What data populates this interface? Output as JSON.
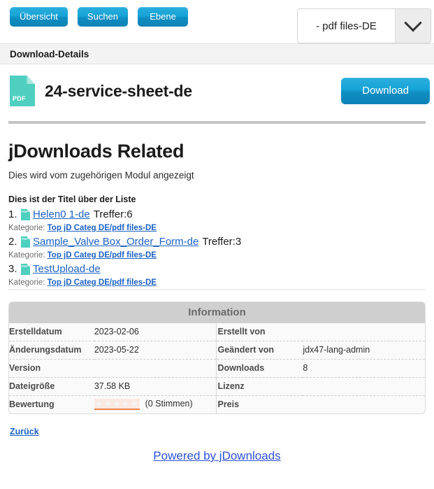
{
  "toolbar": {
    "buttons": [
      {
        "label": "Übersicht",
        "name": "overview-button"
      },
      {
        "label": "Suchen",
        "name": "search-button"
      },
      {
        "label": "Ebene",
        "name": "level-button"
      }
    ],
    "category_select": {
      "value": "- pdf files-DE",
      "icon": "chevron-down-icon"
    }
  },
  "details_band": {
    "title": "Download-Details"
  },
  "download": {
    "file_icon": "pdf-file-icon",
    "file_icon_label": "PDF",
    "title": "24-service-sheet-de",
    "button_label": "Download"
  },
  "related": {
    "heading": "jDownloads Related",
    "lead": "Dies wird vom zugehörigen Modul angezeigt",
    "list_title": "Dies ist der Titel über der Liste",
    "category_prefix": "Kategorie:",
    "items": [
      {
        "number": "1.",
        "link": "Helen0 1-de",
        "hits": "Treffer:6",
        "category": "Top jD Categ DE/pdf files-DE"
      },
      {
        "number": "2.",
        "link": "Sample_Valve Box_Order_Form-de",
        "hits": "Treffer:3",
        "category": "Top jD Categ DE/pdf files-DE"
      },
      {
        "number": "3.",
        "link": "TestUpload-de",
        "hits": "",
        "category": "Top jD Categ DE/pdf files-DE"
      }
    ]
  },
  "info_table": {
    "header": "Information",
    "rows": [
      {
        "left_label": "Erstelldatum",
        "left_value": "2023-02-06",
        "right_label": "Erstellt von",
        "right_value": ""
      },
      {
        "left_label": "Änderungsdatum",
        "left_value": "2023-05-22",
        "right_label": "Geändert von",
        "right_value": "jdx47-lang-admin"
      },
      {
        "left_label": "Version",
        "left_value": "",
        "right_label": "Downloads",
        "right_value": "8"
      },
      {
        "left_label": "Dateigröße",
        "left_value": "37.58 KB",
        "right_label": "Lizenz",
        "right_value": ""
      }
    ],
    "rating": {
      "label": "Bewertung",
      "stars": "★★★★★",
      "votes": "(0 Stimmen)",
      "price_label": "Preis",
      "price_value": ""
    }
  },
  "footer": {
    "back_label": "Zurück",
    "powered_label": "Powered by jDownloads"
  },
  "colors": {
    "button_blue": "#17a3d6",
    "link_blue": "#1b62c4",
    "pdf_teal": "#4fcfc0",
    "table_header_gray": "#cfcfcf",
    "star_orange": "#e8834a"
  }
}
